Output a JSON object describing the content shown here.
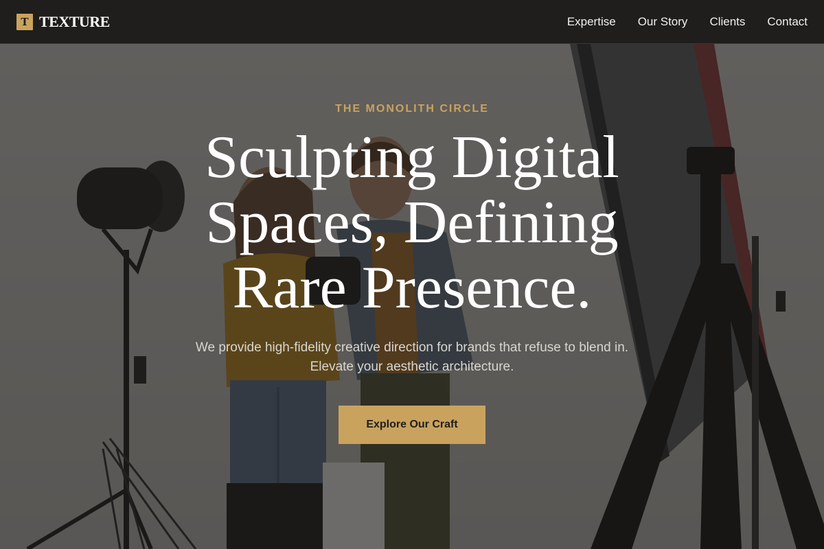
{
  "brand": {
    "mark": "T",
    "name": "TEXTURE"
  },
  "nav": {
    "items": [
      {
        "label": "Expertise"
      },
      {
        "label": "Our Story"
      },
      {
        "label": "Clients"
      },
      {
        "label": "Contact"
      }
    ]
  },
  "hero": {
    "eyebrow": "THE MONOLITH CIRCLE",
    "headline": "Sculpting Digital Spaces, Defining Rare Presence.",
    "subhead": "We provide high-fidelity creative direction for brands that refuse to blend in. Elevate your aesthetic architecture.",
    "cta_label": "Explore Our Craft",
    "background_image": "photo-studio-scene"
  },
  "colors": {
    "accent": "#c9a35e",
    "nav_background": "#1f1e1c",
    "overlay": "rgba(28,26,24,0.62)",
    "text_primary": "#ffffff"
  }
}
